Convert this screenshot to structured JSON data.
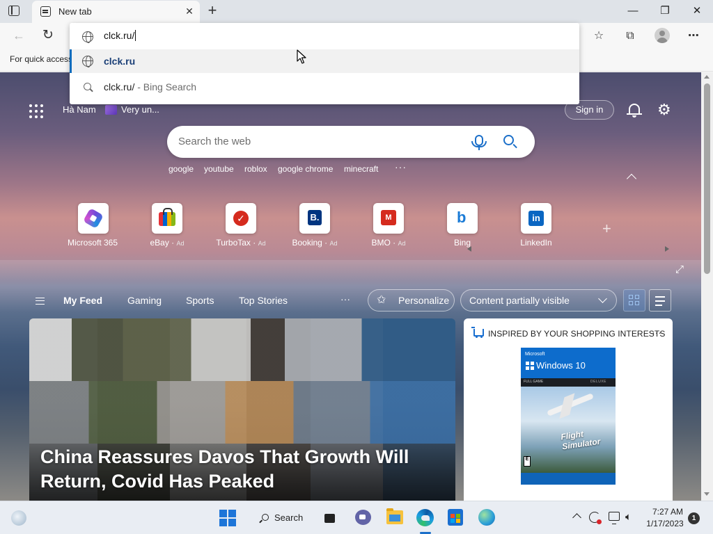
{
  "browser": {
    "tab": {
      "title": "New tab",
      "close_symbol": "✕"
    },
    "new_tab_symbol": "+",
    "window_controls": {
      "minimize": "—",
      "maximize": "❐",
      "close": "✕"
    },
    "address_input_value": "clck.ru/",
    "suggestions": [
      {
        "text": "clck.ru",
        "icon": "globe-icon"
      },
      {
        "text": "clck.ru/",
        "suffix": " - Bing Search",
        "icon": "search-icon"
      }
    ],
    "favorites_bar_text": "For quick access"
  },
  "header": {
    "location": "Hà Nam",
    "weather": "Very un...",
    "signin_label": "Sign in"
  },
  "search": {
    "placeholder": "Search the web",
    "trending": [
      "google",
      "youtube",
      "roblox",
      "google chrome",
      "minecraft"
    ],
    "more": "···"
  },
  "quick_links": [
    {
      "label": "Microsoft 365",
      "ad": "",
      "icon": "microsoft-365-icon"
    },
    {
      "label": "eBay",
      "ad": "Ad",
      "icon": "ebay-icon"
    },
    {
      "label": "TurboTax",
      "ad": "Ad",
      "icon": "turbotax-icon"
    },
    {
      "label": "Booking",
      "ad": "Ad",
      "icon": "booking-icon"
    },
    {
      "label": "BMO",
      "ad": "Ad",
      "icon": "bmo-icon"
    },
    {
      "label": "Bing",
      "ad": "",
      "icon": "bing-icon"
    },
    {
      "label": "LinkedIn",
      "ad": "",
      "icon": "linkedin-icon"
    }
  ],
  "feed": {
    "tabs": [
      "My Feed",
      "Gaming",
      "Sports",
      "Top Stories"
    ],
    "more": "···",
    "personalize_label": "Personalize",
    "visibility_label": "Content partially visible"
  },
  "news": {
    "headline": "China Reassures Davos That Growth Will Return, Covid Has Peaked"
  },
  "shopping": {
    "title": "INSPIRED BY YOUR SHOPPING INTERESTS",
    "more": "···",
    "product": {
      "brand": "Microsoft",
      "platform": "Windows 10",
      "edition_left": "FULL GAME",
      "edition_right": "DELUXE",
      "name": "Flight Simulator",
      "rating": "E"
    }
  },
  "taskbar": {
    "search_label": "Search",
    "time": "7:27 AM",
    "date": "1/17/2023",
    "notifications": "1"
  },
  "colors": {
    "accent": "#0f6cbd",
    "suggestion_text": "#1a3f77",
    "taskbar_bg": "#e9edf3"
  }
}
